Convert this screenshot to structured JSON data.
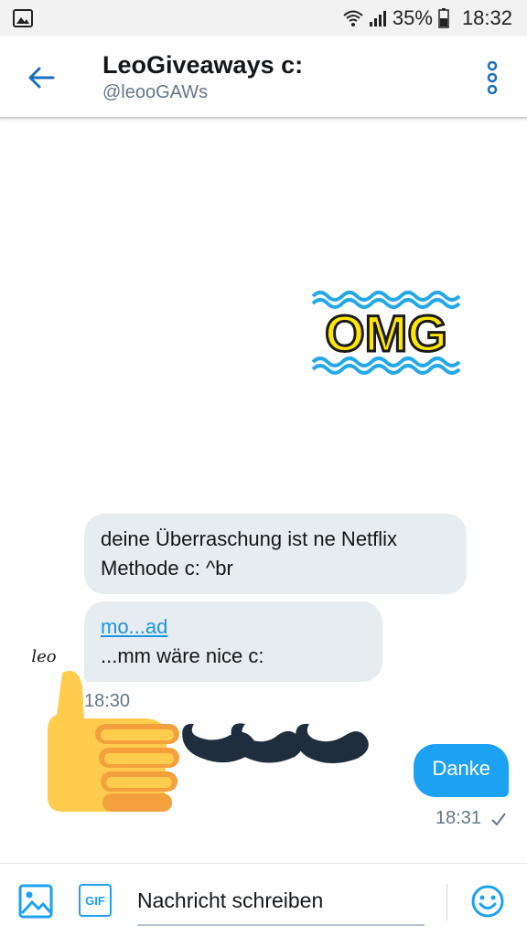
{
  "status_bar": {
    "battery": "35%",
    "time": "18:32",
    "icons": [
      "image-notification-icon",
      "wifi-icon",
      "cell-signal-icon",
      "battery-icon"
    ]
  },
  "header": {
    "title": "LeoGiveaways c:",
    "handle": "@leooGAWs",
    "icons": [
      "back-arrow-icon",
      "more-vertical-icon"
    ]
  },
  "conversation": {
    "sticker_text": "OMG",
    "incoming": [
      {
        "lines": [
          "deine Überraschung ist ne Netflix",
          "Methode c: ^br"
        ]
      },
      {
        "lines": [
          "mo...ad",
          "...mm wäre nice c:"
        ]
      }
    ],
    "incoming_time": "18:30",
    "outgoing": {
      "text": "Danke",
      "time": "18:31",
      "status_icon": "check-icon"
    },
    "avatar_text": "leo"
  },
  "composer": {
    "placeholder": "Nachricht schreiben",
    "gif_label": "GIF",
    "icons": [
      "image-icon",
      "gif-icon",
      "smiley-icon"
    ]
  },
  "colors": {
    "accent": "#1da1f2",
    "bubble_in": "#e6ecf0",
    "sticker_yellow": "#ffe600",
    "sticker_wave": "#24a8e8"
  }
}
